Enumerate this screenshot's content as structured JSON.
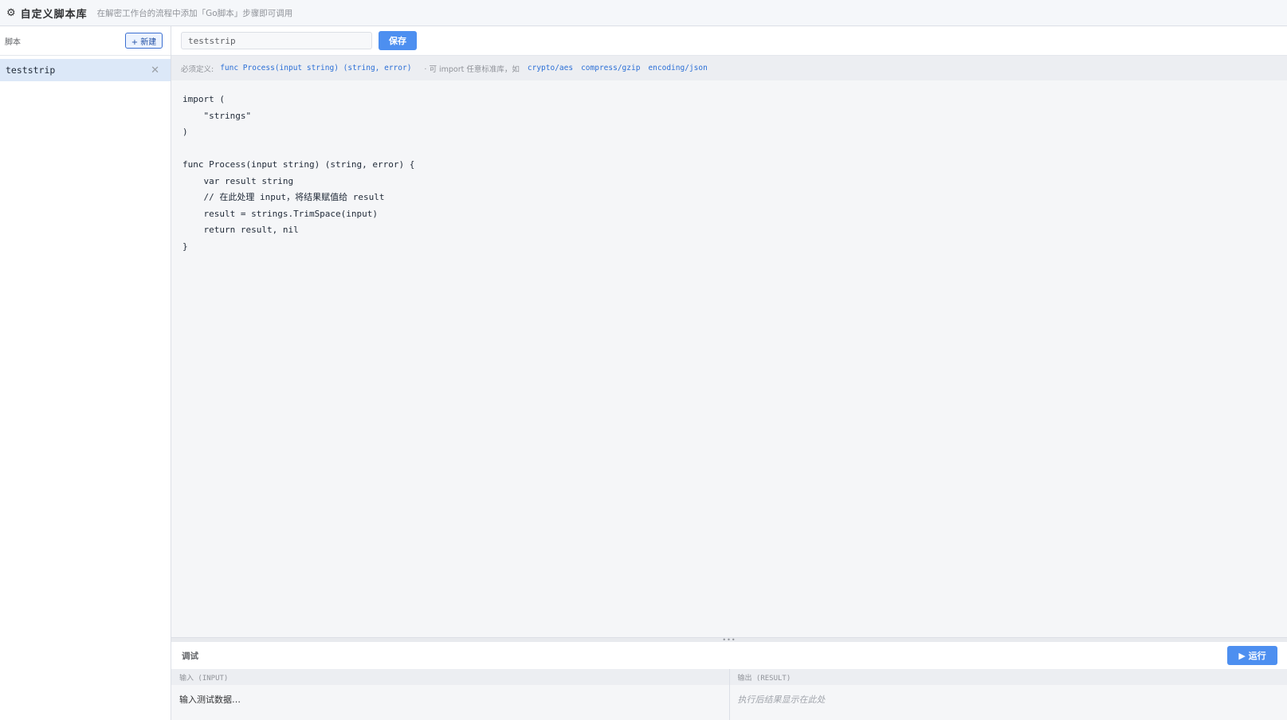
{
  "header": {
    "icon": "gear-icon",
    "title": "自定义脚本库",
    "subtitle": "在解密工作台的流程中添加「Go脚本」步骤即可调用"
  },
  "sidebar": {
    "label": "脚本",
    "new_button": "+ 新建",
    "items": [
      {
        "name": "teststrip",
        "selected": true,
        "close_icon": "close-icon"
      }
    ]
  },
  "toolbar": {
    "name_value": "teststrip",
    "save_label": "保存"
  },
  "hint": {
    "prefix": "必须定义:",
    "signature": "func Process(input string) (string, error)",
    "middle": "· 可 import 任意标准库，如",
    "packages": [
      "crypto/aes",
      "compress/gzip",
      "encoding/json"
    ]
  },
  "editor": {
    "lines": [
      "import (",
      "    \"strings\"",
      ")",
      "",
      "func Process(input string) (string, error) {",
      "    var result string",
      "    // 在此处理 input，将结果赋值给 result",
      "    result = strings.TrimSpace(input)",
      "    return result, nil",
      "}"
    ]
  },
  "debug": {
    "label": "调试",
    "run_label": "▶ 运行",
    "input_label": "输入 (INPUT)",
    "input_placeholder": "输入测试数据…",
    "output_label": "输出 (RESULT)",
    "output_placeholder": "执行后结果显示在此处"
  },
  "colors": {
    "accent": "#4d8ff0",
    "selected_item_bg": "#dce8f8",
    "code_link": "#2b6fd6"
  }
}
